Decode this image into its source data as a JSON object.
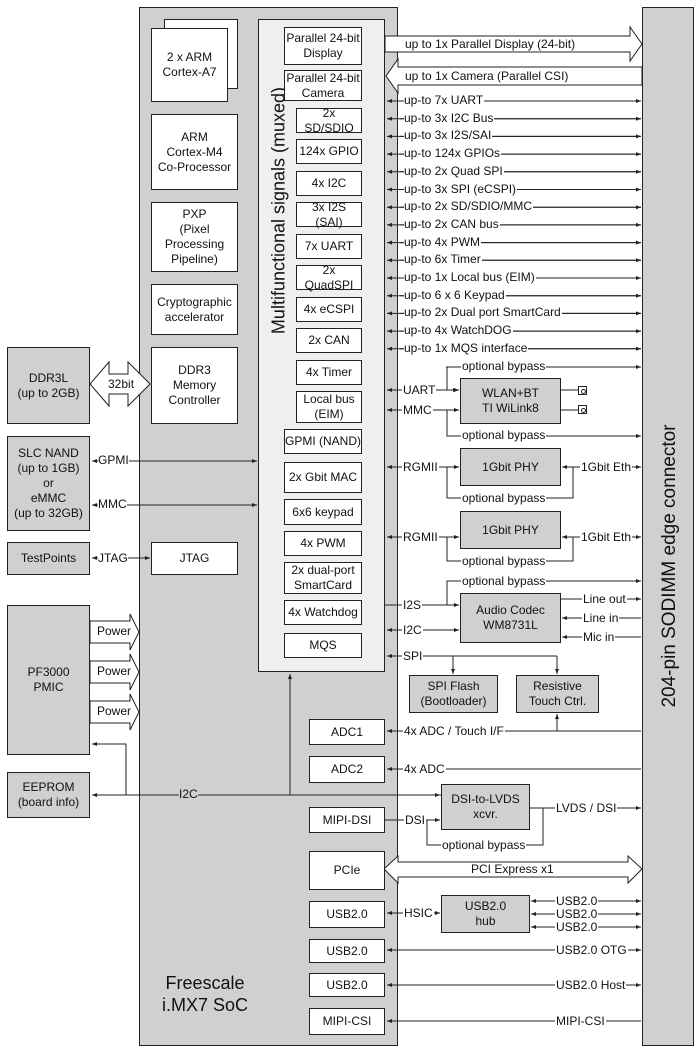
{
  "soc": {
    "title": "Freescale\ni.MX7 SoC",
    "cores": [
      {
        "label": "2 x ARM\nCortex-A7"
      },
      {
        "label": "ARM\nCortex-M4\nCo-Processor"
      },
      {
        "label": "PXP\n(Pixel\nProcessing\nPipeline)"
      },
      {
        "label": "Cryptographic\naccelerator"
      },
      {
        "label": "DDR3\nMemory\nController"
      },
      {
        "label": "JTAG"
      }
    ],
    "mux_title": "Multifunctional signals (muxed)",
    "mux_blocks": [
      "Parallel 24-bit\nDisplay",
      "Parallel 24-bit\nCamera",
      "2x SD/SDIO",
      "124x GPIO",
      "4x I2C",
      "3x I2S (SAI)",
      "7x UART",
      "2x QuadSPI",
      "4x eCSPI",
      "2x CAN",
      "4x Timer",
      "Local bus\n(EIM)",
      "GPMI (NAND)",
      "2x Gbit MAC",
      "6x6 keypad",
      "4x PWM",
      "2x dual-port\nSmartCard",
      "4x Watchdog",
      "MQS"
    ],
    "lower_blocks": [
      "ADC1",
      "ADC2",
      "MIPI-DSI",
      "PCIe",
      "USB2.0",
      "USB2.0",
      "USB2.0",
      "MIPI-CSI"
    ]
  },
  "external": {
    "ddr": "DDR3L\n(up to 2GB)",
    "ddr_bus": "32bit",
    "nand": "SLC NAND\n(up to 1GB)\nor\neMMC\n(up to 32GB)",
    "gpmi": "GPMI",
    "mmc": "MMC",
    "testpoints": "TestPoints",
    "jtag": "JTAG",
    "pmic": "PF3000\nPMIC",
    "power": [
      "Power",
      "Power",
      "Power"
    ],
    "eeprom": "EEPROM\n(board info)",
    "i2c": "I2C"
  },
  "connector": {
    "label": "204-pin SODIMM edge connector"
  },
  "buses": {
    "display": "up to 1x Parallel Display (24-bit)",
    "camera": "up to 1x Camera (Parallel CSI)",
    "signals": [
      "up-to 7x UART",
      "up-to 3x I2C Bus",
      "up-to 3x I2S/SAI",
      "up-to 124x GPIOs",
      "up-to 2x Quad SPI",
      "up-to 3x SPI (eCSPI)",
      "up-to 2x SD/SDIO/MMC",
      "up-to 2x CAN bus",
      "up-to 4x PWM",
      "up-to 6x Timer",
      "up-to 1x Local bus (EIM)",
      "up-to 6 x 6 Keypad",
      "up-to 2x Dual port SmartCard",
      "up-to 4x WatchDOG",
      "up-to 1x MQS interface"
    ]
  },
  "peripherals": {
    "wlan": "WLAN+BT\nTI WiLink8",
    "uart": "UART",
    "mmc": "MMC",
    "bypass": "optional bypass",
    "phy": "1Gbit PHY",
    "rgmii": "RGMII",
    "eth": "1Gbit Eth",
    "codec": "Audio Codec\nWM8731L",
    "i2s": "I2S",
    "i2c": "I2C",
    "line_out": "Line out",
    "line_in": "Line in",
    "mic_in": "Mic in",
    "spi": "SPI",
    "spi_flash": "SPI Flash\n(Bootloader)",
    "touch": "Resistive\nTouch Ctrl.",
    "adc_touch": "4x ADC / Touch I/F",
    "adc": "4x ADC",
    "dsi_lvds": "DSI-to-LVDS\nxcvr.",
    "dsi": "DSI",
    "lvds_dsi": "LVDS / DSI",
    "pcie": "PCI Express x1",
    "hsic": "HSIC",
    "usb_hub": "USB2.0\nhub",
    "usb": "USB2.0",
    "usb_otg": "USB2.0 OTG",
    "usb_host": "USB2.0 Host",
    "mipi_csi": "MIPI-CSI"
  }
}
